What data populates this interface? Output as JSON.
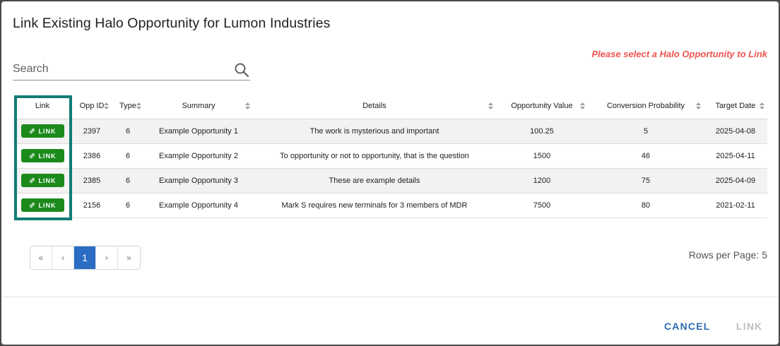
{
  "dialog": {
    "title": "Link Existing Halo Opportunity for Lumon Industries",
    "warning": "Please select a Halo Opportunity to Link"
  },
  "search": {
    "placeholder": "Search",
    "value": ""
  },
  "table": {
    "columns": [
      "Link",
      "Opp ID",
      "Type",
      "Summary",
      "Details",
      "Opportunity Value",
      "Conversion Probability",
      "Target Date"
    ],
    "link_button_label": "LINK",
    "rows": [
      {
        "opp_id": "2397",
        "type": "6",
        "summary": "Example Opportunity 1",
        "details": "The work is mysterious and important",
        "value": "100.25",
        "probability": "5",
        "target_date": "2025-04-08"
      },
      {
        "opp_id": "2386",
        "type": "6",
        "summary": "Example Opportunity 2",
        "details": "To opportunity or not to opportunity, that is the question",
        "value": "1500",
        "probability": "46",
        "target_date": "2025-04-11"
      },
      {
        "opp_id": "2385",
        "type": "6",
        "summary": "Example Opportunity 3",
        "details": "These are example details",
        "value": "1200",
        "probability": "75",
        "target_date": "2025-04-09"
      },
      {
        "opp_id": "2156",
        "type": "6",
        "summary": "Example Opportunity 4",
        "details": "Mark S requires new terminals for 3 members of MDR",
        "value": "7500",
        "probability": "80",
        "target_date": "2021-02-11"
      }
    ]
  },
  "pagination": {
    "first": "«",
    "prev": "‹",
    "current": "1",
    "next": "›",
    "last": "»"
  },
  "rows_per_page": "Rows per Page: 5",
  "actions": {
    "cancel": "CANCEL",
    "link": "LINK"
  },
  "colors": {
    "link_button": "#1b8a1b",
    "highlight": "#0f7d75",
    "warning": "#ef5350",
    "primary": "#2b6cc4"
  }
}
